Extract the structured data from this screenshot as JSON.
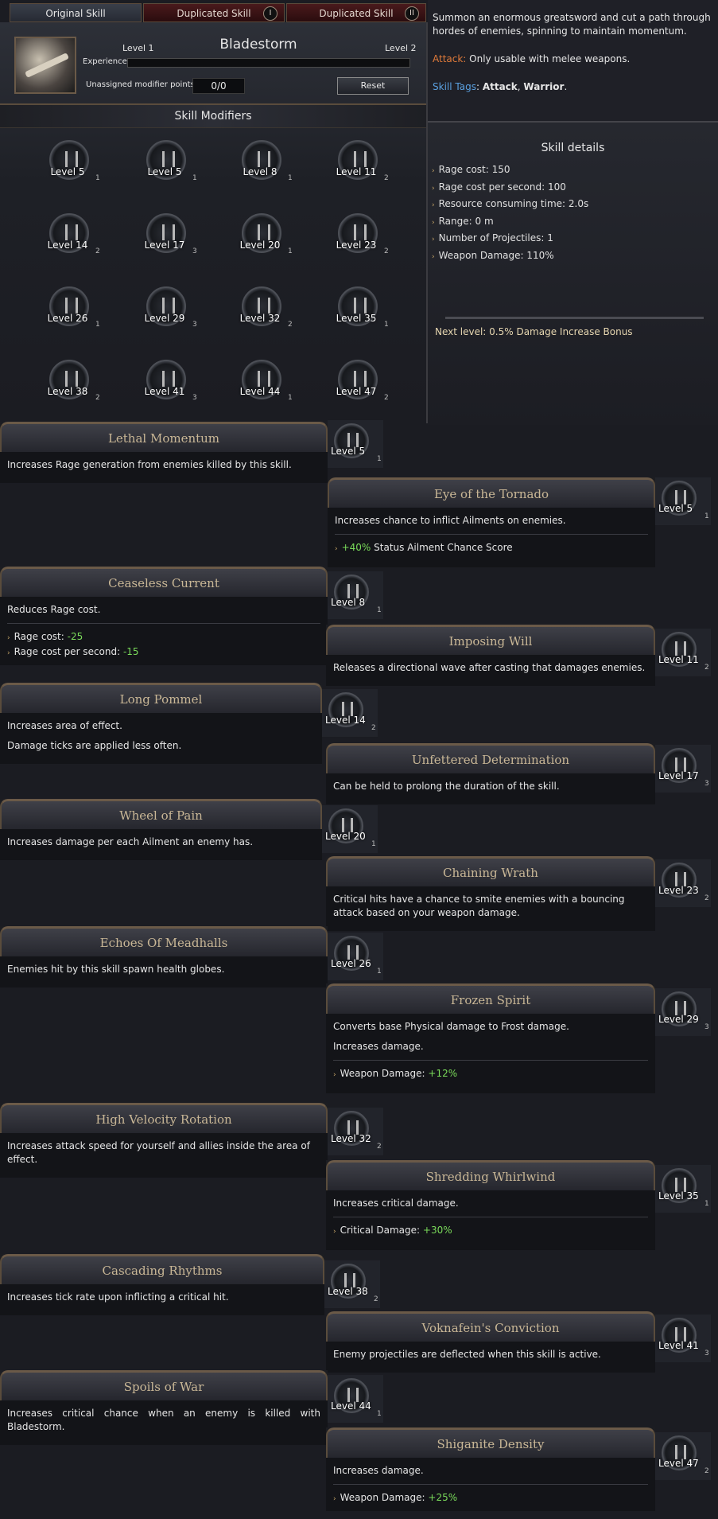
{
  "tabs": {
    "original": "Original Skill",
    "dup1": "Duplicated Skill",
    "dup1_num": "I",
    "dup2": "Duplicated Skill",
    "dup2_num": "II"
  },
  "skill": {
    "name": "Bladestorm",
    "level_left": "Level 1",
    "level_right": "Level 2",
    "experience_label": "Experience",
    "experience_progress": 0,
    "unassigned_label": "Unassigned modifier points",
    "unassigned_value": "0/0",
    "reset_label": "Reset",
    "modifiers_header": "Skill Modifiers"
  },
  "description": {
    "text": "Summon an enormous greatsword and cut a path through hordes of enemies, spinning to maintain momentum.",
    "attack_key": "Attack:",
    "attack_text": " Only usable with melee weapons.",
    "tags_key": "Skill Tags",
    "tags_sep": ": ",
    "tag1": "Attack",
    "tag_comma": ", ",
    "tag2": "Warrior",
    "tag_end": "."
  },
  "details": {
    "title": "Skill details",
    "items": [
      "Rage cost: 150",
      "Rage cost per second: 100",
      "Resource consuming time: 2.0s",
      "Range: 0 m",
      "Number of Projectiles: 1",
      "Weapon Damage: 110%"
    ],
    "next_level": "Next level: 0.5% Damage Increase Bonus"
  },
  "modifiers": [
    {
      "level": "Level 5",
      "count": "1"
    },
    {
      "level": "Level 5",
      "count": "1"
    },
    {
      "level": "Level 8",
      "count": "1"
    },
    {
      "level": "Level 11",
      "count": "2"
    },
    {
      "level": "Level 14",
      "count": "2"
    },
    {
      "level": "Level 17",
      "count": "3"
    },
    {
      "level": "Level 20",
      "count": "1"
    },
    {
      "level": "Level 23",
      "count": "2"
    },
    {
      "level": "Level 26",
      "count": "1"
    },
    {
      "level": "Level 29",
      "count": "3"
    },
    {
      "level": "Level 32",
      "count": "2"
    },
    {
      "level": "Level 35",
      "count": "1"
    },
    {
      "level": "Level 38",
      "count": "2"
    },
    {
      "level": "Level 41",
      "count": "3"
    },
    {
      "level": "Level 44",
      "count": "1"
    },
    {
      "level": "Level 47",
      "count": "2"
    }
  ],
  "tooltips": {
    "t1": {
      "title": "Lethal Momentum",
      "l1": "Increases Rage generation from enemies killed by this skill.",
      "lvl": "Level 5",
      "cnt": "1"
    },
    "t2": {
      "title": "Eye of the Tornado",
      "l1": "Increases chance to inflict Ailments on enemies.",
      "s1v": "+40%",
      "s1": " Status Ailment Chance Score",
      "lvl": "Level 5",
      "cnt": "1"
    },
    "t3": {
      "title": "Ceaseless Current",
      "l1": "Reduces Rage cost.",
      "s1": "Rage cost: ",
      "s1v": "-25",
      "s2": "Rage cost per second: ",
      "s2v": "-15",
      "lvl": "Level 8",
      "cnt": "1"
    },
    "t4": {
      "title": "Imposing Will",
      "l1": "Releases a directional wave after casting that damages enemies.",
      "lvl": "Level 11",
      "cnt": "2"
    },
    "t5": {
      "title": "Long Pommel",
      "l1": "Increases area of effect.",
      "l2": "Damage ticks are applied less often.",
      "lvl": "Level 14",
      "cnt": "2"
    },
    "t6": {
      "title": "Unfettered Determination",
      "l1": "Can be held to prolong the duration of the skill.",
      "lvl": "Level 17",
      "cnt": "3"
    },
    "t7": {
      "title": "Wheel of Pain",
      "l1": "Increases damage per each Ailment an enemy has.",
      "lvl": "Level 20",
      "cnt": "1"
    },
    "t8": {
      "title": "Chaining Wrath",
      "l1": "Critical hits have a chance to smite enemies with a bouncing attack based on your weapon damage.",
      "lvl": "Level 23",
      "cnt": "2"
    },
    "t9": {
      "title": "Echoes Of Meadhalls",
      "l1": "Enemies hit by this skill spawn health globes.",
      "lvl": "Level 26",
      "cnt": "1"
    },
    "t10": {
      "title": "Frozen Spirit",
      "l1": "Converts base Physical damage to Frost damage.",
      "l2": "Increases damage.",
      "s1": "Weapon Damage: ",
      "s1v": "+12%",
      "lvl": "Level 29",
      "cnt": "3"
    },
    "t11": {
      "title": "High Velocity Rotation",
      "l1": "Increases attack speed for yourself and allies inside the area of effect.",
      "lvl": "Level 32",
      "cnt": "2"
    },
    "t12": {
      "title": "Shredding Whirlwind",
      "l1": "Increases critical damage.",
      "s1": "Critical Damage: ",
      "s1v": "+30%",
      "lvl": "Level 35",
      "cnt": "1"
    },
    "t13": {
      "title": "Cascading Rhythms",
      "l1": "Increases tick rate upon inflicting a critical hit.",
      "lvl": "Level 38",
      "cnt": "2"
    },
    "t14": {
      "title": "Voknafein's Conviction",
      "l1": "Enemy projectiles are deflected when this skill is active.",
      "lvl": "Level 41",
      "cnt": "3"
    },
    "t15": {
      "title": "Spoils of War",
      "l1": "Increases critical chance when an enemy is killed with Bladestorm.",
      "lvl": "Level 44",
      "cnt": "1"
    },
    "t16": {
      "title": "Shiganite Density",
      "l1": "Increases damage.",
      "s1": "Weapon Damage: ",
      "s1v": "+25%",
      "lvl": "Level 47",
      "cnt": "2"
    }
  }
}
